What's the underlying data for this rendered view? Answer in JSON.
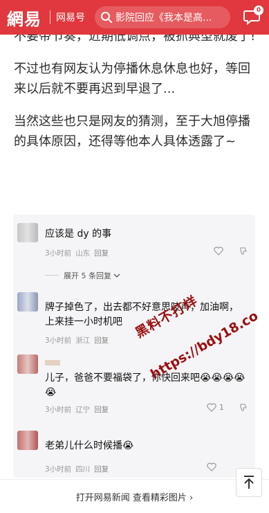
{
  "header": {
    "logo": "網易",
    "subbrand": "网易号",
    "search_text": "影院回应《我本是高...",
    "msg_count": "0"
  },
  "article": {
    "paragraphs": [
      "不要带节奏，近期低调点，被抓典型就废了!",
      "不过也有网友认为停播休息休息也好，等回来以后就不要再迟到早退了...",
      "当然这些也只是网友的猜测，至于大旭停播的具体原因，还得等他本人具体透露了~"
    ]
  },
  "comments": [
    {
      "text": "应该是 dy 的事",
      "time": "3小时前",
      "place": "山东",
      "reply": "回复",
      "likes": ""
    },
    {
      "text": "牌子掉色了，出去都不好意思吱声，加油啊，上来挂一小时机吧",
      "time": "3小时前",
      "place": "浙江",
      "reply": "回复",
      "likes": ""
    },
    {
      "text": "儿子，爸爸不要福袋了，你快回来吧😭😭😭😭😭",
      "time": "3小时前",
      "place": "辽宁",
      "reply": "回复",
      "likes": "1"
    },
    {
      "text": "老弟儿什么时候播😭",
      "time": "3小时前",
      "place": "四川",
      "reply": "回复",
      "likes": ""
    }
  ],
  "expand_label": "展开 5 条回复",
  "watermark": {
    "line1": "黑料不打烊",
    "line2": "https://bdy18.co"
  },
  "bottom": {
    "open_link": "打开网易新闻 查看精彩图片 ›"
  },
  "colors": {
    "brand_red": "#e0383e"
  }
}
